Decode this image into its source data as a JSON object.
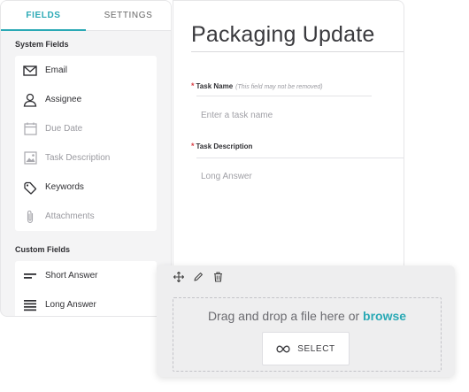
{
  "tabs": [
    {
      "label": "FIELDS",
      "active": true
    },
    {
      "label": "SETTINGS",
      "active": false
    }
  ],
  "system_fields": {
    "title": "System Fields",
    "items": [
      {
        "label": "Email",
        "icon": "envelope-icon",
        "enabled": true
      },
      {
        "label": "Assignee",
        "icon": "user-icon",
        "enabled": true
      },
      {
        "label": "Due Date",
        "icon": "calendar-icon",
        "enabled": false
      },
      {
        "label": "Task Description",
        "icon": "image-icon",
        "enabled": false
      },
      {
        "label": "Keywords",
        "icon": "tag-icon",
        "enabled": true
      },
      {
        "label": "Attachments",
        "icon": "paperclip-icon",
        "enabled": false
      }
    ]
  },
  "custom_fields": {
    "title": "Custom Fields",
    "items": [
      {
        "label": "Short Answer",
        "icon": "short-answer-icon"
      },
      {
        "label": "Long Answer",
        "icon": "long-answer-icon"
      }
    ]
  },
  "form": {
    "title": "Packaging Update",
    "task_name": {
      "label": "Task Name",
      "hint": "(This field may not be removed)",
      "placeholder": "Enter a task name",
      "required": true
    },
    "task_description": {
      "label": "Task Description",
      "placeholder": "Long Answer",
      "required": true
    }
  },
  "upload": {
    "drop_text": "Drag and drop a file here or",
    "browse_label": "browse",
    "select_label": "SELECT"
  },
  "colors": {
    "accent": "#2aa9b5",
    "required": "#d9434a"
  }
}
